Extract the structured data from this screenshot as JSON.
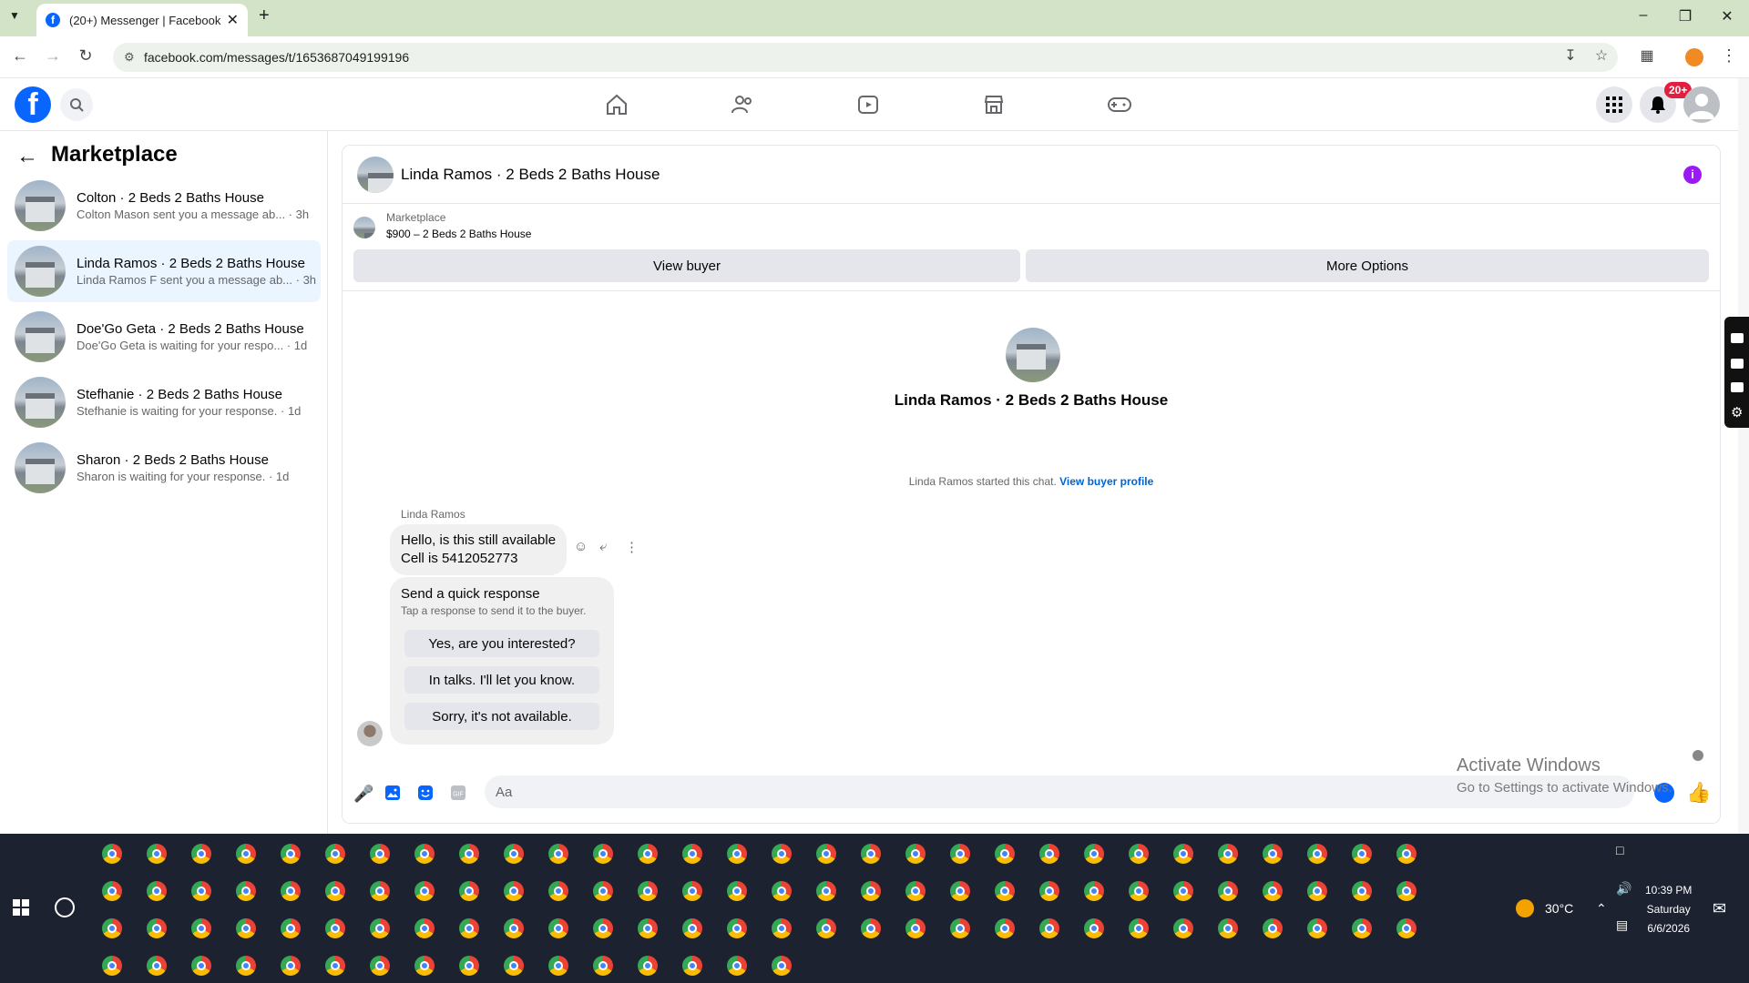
{
  "browser": {
    "tab_title": "(20+) Messenger | Facebook",
    "url": "facebook.com/messages/t/1653687049199196"
  },
  "header": {
    "notification_badge": "20+"
  },
  "sidebar": {
    "title": "Marketplace",
    "conversations": [
      {
        "name": "Colton · 2 Beds 2 Baths House",
        "preview": "Colton Mason sent you a message ab... · 3h",
        "active": false
      },
      {
        "name": "Linda Ramos · 2 Beds 2 Baths House",
        "preview": "Linda Ramos F sent you a message ab... · 3h",
        "active": true
      },
      {
        "name": "Doe'Go Geta · 2 Beds 2 Baths House",
        "preview": "Doe'Go Geta is waiting for your respo... · 1d",
        "active": false
      },
      {
        "name": "Stefhanie · 2 Beds 2 Baths House",
        "preview": "Stefhanie is waiting for your response. · 1d",
        "active": false
      },
      {
        "name": "Sharon · 2 Beds 2 Baths House",
        "preview": "Sharon is waiting for your response. · 1d",
        "active": false
      }
    ]
  },
  "chat": {
    "title": "Linda Ramos · 2 Beds 2 Baths House",
    "marketplace_label": "Marketplace",
    "listing": "$900 – 2 Beds 2 Baths House",
    "view_buyer_label": "View buyer",
    "more_options_label": "More Options",
    "profile_name": "Linda Ramos · 2 Beds 2 Baths House",
    "started_text": "Linda Ramos started this chat.",
    "view_profile_link": "View buyer profile",
    "sender_name": "Linda Ramos",
    "message_line1": "Hello, is this still available",
    "message_line2": "Cell is 5412052773",
    "quick_title": "Send a quick response",
    "quick_subtitle": "Tap a response to send it to the buyer.",
    "quick_responses": [
      "Yes, are you interested?",
      "In talks. I'll let you know.",
      "Sorry, it's not available."
    ],
    "composer_placeholder": "Aa"
  },
  "watermark": {
    "line1": "Activate Windows",
    "line2": "Go to Settings to activate Windows."
  },
  "taskbar": {
    "temperature": "30°C",
    "time": "10:39 PM",
    "day": "Saturday",
    "date": "6/6/2026"
  },
  "colors": {
    "facebook_blue": "#0866ff",
    "active_conversation": "#ebf5ff",
    "info_purple": "#9b19f5",
    "badge_red": "#e41e3f"
  }
}
